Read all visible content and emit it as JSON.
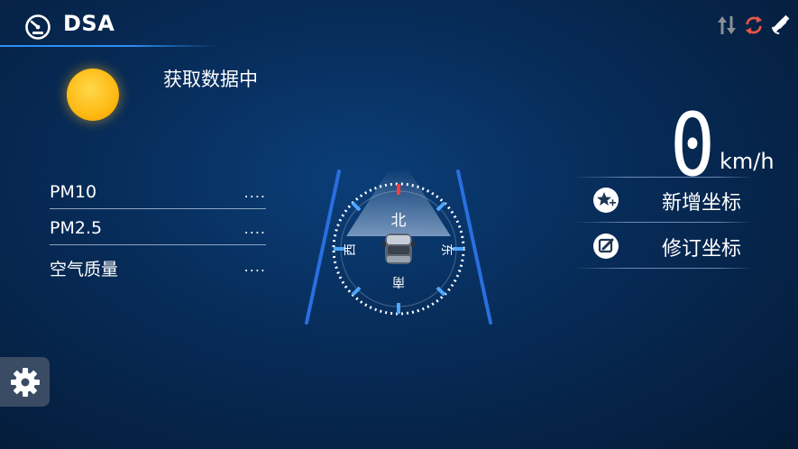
{
  "header": {
    "title": "DSA"
  },
  "weather": {
    "status": "获取数据中"
  },
  "air_quality": [
    {
      "label": "PM10",
      "value": "...."
    },
    {
      "label": "PM2.5",
      "value": "...."
    },
    {
      "label": "空气质量",
      "value": "...."
    }
  ],
  "compass": {
    "north": "北",
    "east": "东",
    "south": "南",
    "west": "西"
  },
  "speed": {
    "value": "0",
    "unit": "km/h"
  },
  "actions": {
    "add": "新增坐标",
    "edit": "修订坐标"
  },
  "colors": {
    "accent": "#2f8ff0",
    "sync": "#e8564a",
    "sun": "#fdb913"
  }
}
